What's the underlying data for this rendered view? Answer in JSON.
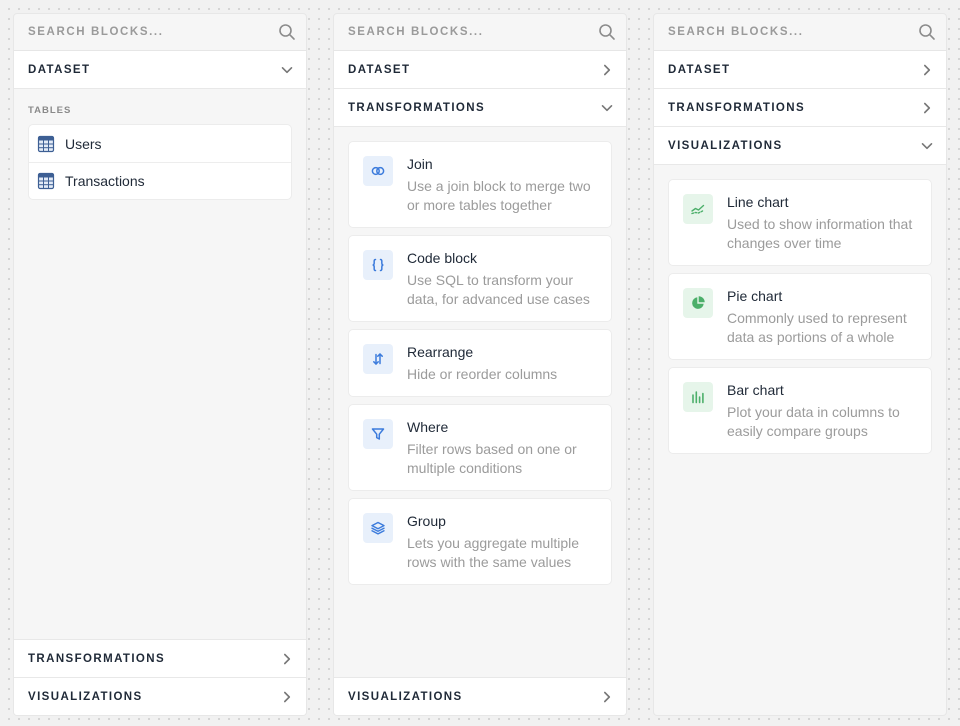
{
  "colors": {
    "accent_blue": "#3b7bdc",
    "accent_green": "#4caf6a",
    "text_primary": "#1f2937",
    "text_muted": "#9b9b9b"
  },
  "panels": [
    {
      "search": {
        "placeholder": "SEARCH BLOCKS..."
      },
      "sections": {
        "dataset": {
          "label": "DATASET",
          "state": "expanded"
        },
        "transformations": {
          "label": "TRANSFORMATIONS",
          "state": "collapsed"
        },
        "visualizations": {
          "label": "VISUALIZATIONS",
          "state": "collapsed"
        }
      },
      "tables_label": "TABLES",
      "tables": [
        {
          "label": "Users",
          "icon": "table-icon"
        },
        {
          "label": "Transactions",
          "icon": "table-icon"
        }
      ]
    },
    {
      "search": {
        "placeholder": "SEARCH BLOCKS..."
      },
      "sections": {
        "dataset": {
          "label": "DATASET",
          "state": "collapsed"
        },
        "transformations": {
          "label": "TRANSFORMATIONS",
          "state": "expanded"
        },
        "visualizations": {
          "label": "VISUALIZATIONS",
          "state": "collapsed"
        }
      },
      "blocks": [
        {
          "title": "Join",
          "description": "Use a join block to merge two or more tables together",
          "icon": "join-icon"
        },
        {
          "title": "Code block",
          "description": "Use SQL to transform your data, for advanced use cases",
          "icon": "braces-icon"
        },
        {
          "title": "Rearrange",
          "description": "Hide or reorder columns",
          "icon": "swap-arrows-icon"
        },
        {
          "title": "Where",
          "description": "Filter rows based on one or multiple conditions",
          "icon": "filter-icon"
        },
        {
          "title": "Group",
          "description": "Lets you aggregate multiple rows with the same values",
          "icon": "layers-icon"
        }
      ]
    },
    {
      "search": {
        "placeholder": "SEARCH BLOCKS..."
      },
      "sections": {
        "dataset": {
          "label": "DATASET",
          "state": "collapsed"
        },
        "transformations": {
          "label": "TRANSFORMATIONS",
          "state": "collapsed"
        },
        "visualizations": {
          "label": "VISUALIZATIONS",
          "state": "expanded"
        }
      },
      "blocks": [
        {
          "title": "Line chart",
          "description": "Used to show information that changes over time",
          "icon": "line-chart-icon"
        },
        {
          "title": "Pie chart",
          "description": "Commonly used to represent data as portions of a whole",
          "icon": "pie-chart-icon"
        },
        {
          "title": "Bar chart",
          "description": "Plot your data in columns to easily compare groups",
          "icon": "bar-chart-icon"
        }
      ]
    }
  ]
}
